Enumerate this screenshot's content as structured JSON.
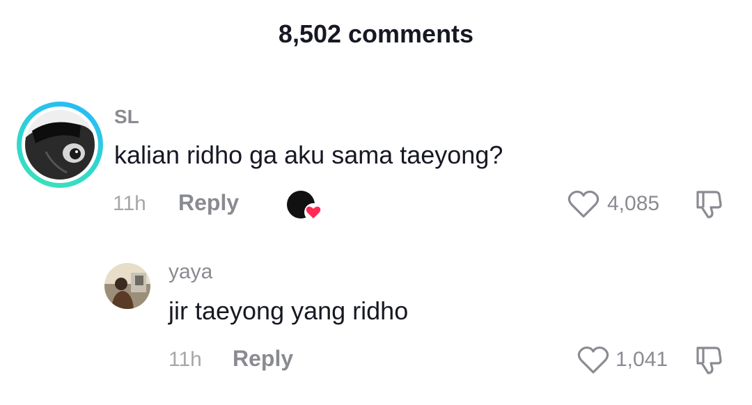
{
  "header": {
    "title": "8,502 comments"
  },
  "comments": [
    {
      "username": "SL",
      "text": "kalian ridho ga aku sama taeyong?",
      "time": "11h",
      "reply_label": "Reply",
      "likes": "4,085",
      "liked_by_creator": true
    },
    {
      "username": "yaya",
      "text": "jir taeyong yang ridho",
      "time": "11h",
      "reply_label": "Reply",
      "likes": "1,041",
      "liked_by_creator": false
    }
  ],
  "colors": {
    "text_primary": "#161823",
    "text_secondary": "#8a8b91",
    "avatar_ring_start": "#25b5ff",
    "avatar_ring_end": "#3ee2b8",
    "creator_heart": "#fe2c55"
  }
}
